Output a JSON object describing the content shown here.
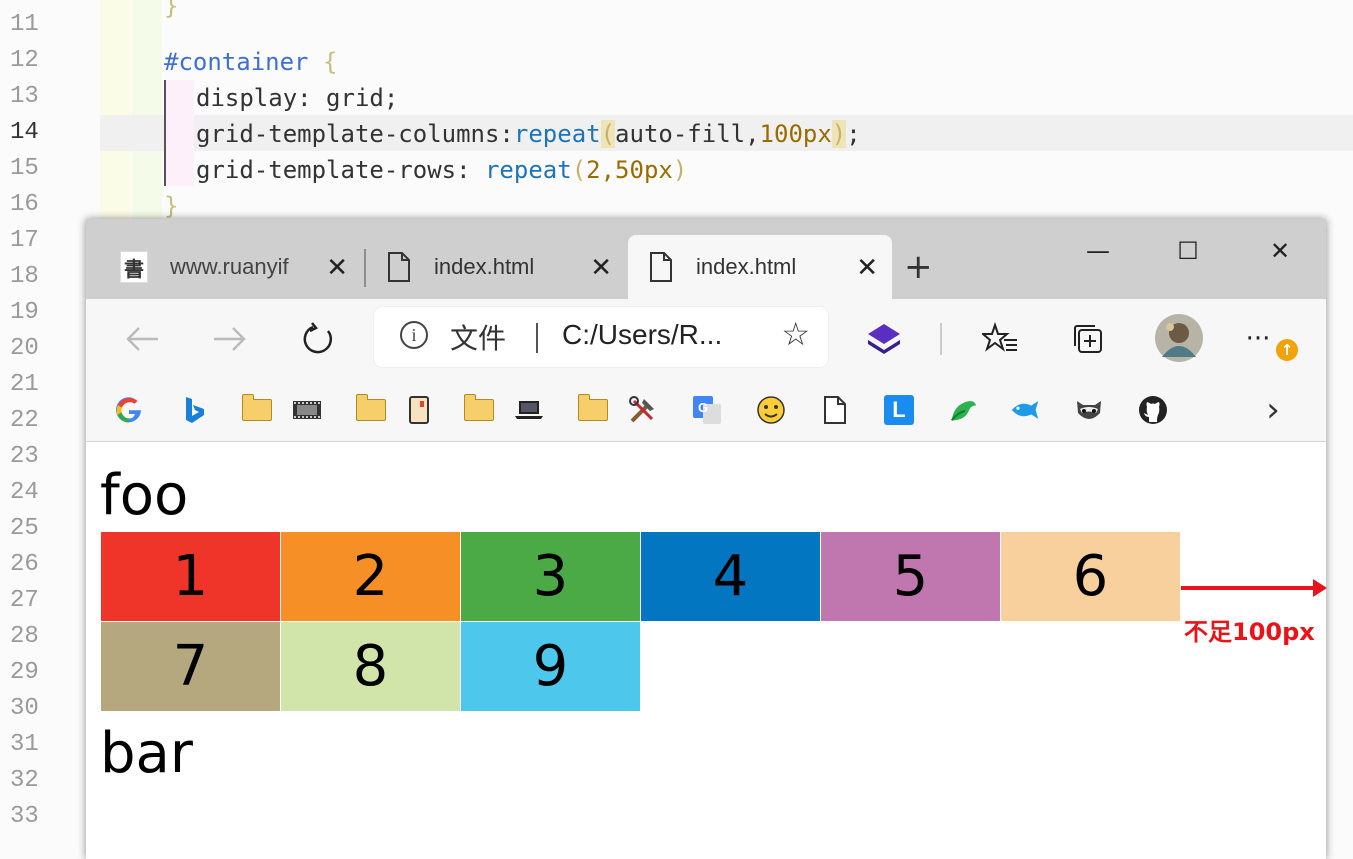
{
  "editor": {
    "line_numbers": [
      "11",
      "12",
      "13",
      "14",
      "15",
      "16",
      "17",
      "18",
      "19",
      "20",
      "21",
      "22",
      "23",
      "24",
      "25",
      "26",
      "27",
      "28",
      "29",
      "30",
      "31",
      "32",
      "33"
    ],
    "active_line": "14",
    "code": {
      "l11": "}",
      "l12_selector": "#container",
      "l12_brace": " {",
      "l13": "display: grid;",
      "l14_prop": "grid-template-columns:",
      "l14_fn": "repeat",
      "l14_open": "(",
      "l14_arg1": "auto-fill,",
      "l14_arg2": "100px",
      "l14_close": ")",
      "l14_end": ";",
      "l15_prop": "grid-template-rows: ",
      "l15_fn": "repeat",
      "l15_open": "(",
      "l15_arg1": "2,",
      "l15_arg2": "50px",
      "l15_close": ")",
      "l16": "}"
    }
  },
  "browser": {
    "tabs": [
      {
        "label": "www.ruanyif",
        "icon": "calligraphy-favicon",
        "close": "✕"
      },
      {
        "label": "index.html",
        "icon": "document-icon",
        "close": "✕"
      },
      {
        "label": "index.html",
        "icon": "document-icon",
        "close": "✕",
        "active": true
      }
    ],
    "new_tab": "+",
    "window_controls": {
      "minimize": "—",
      "maximize": "☐",
      "close": "✕"
    },
    "address": {
      "info": "i",
      "scheme_label": "文件",
      "url": "C:/Users/R...",
      "star": "☆"
    },
    "toolbar_icons": [
      "back-icon",
      "forward-icon",
      "refresh-icon",
      "extension-layers-icon",
      "favorites-icon",
      "collections-icon",
      "profile-avatar",
      "more-icon"
    ],
    "more_label": "···",
    "update_badge": "↑",
    "bookmarks": [
      "google",
      "bing",
      "folder-film",
      "folder-book",
      "folder-laptop",
      "folder-tools",
      "translate",
      "emoji",
      "document",
      "L-app",
      "bird",
      "fish",
      "raccoon",
      "github"
    ],
    "bookmarks_more": "›",
    "bm_l_label": "L"
  },
  "page": {
    "foo": "foo",
    "bar": "bar",
    "cells": [
      {
        "label": "1",
        "color": "#ef342a"
      },
      {
        "label": "2",
        "color": "#f68f26"
      },
      {
        "label": "3",
        "color": "#4ba946"
      },
      {
        "label": "4",
        "color": "#0376c2"
      },
      {
        "label": "5",
        "color": "#c077af"
      },
      {
        "label": "6",
        "color": "#f8d09d"
      },
      {
        "label": "7",
        "color": "#b5a87f"
      },
      {
        "label": "8",
        "color": "#d1e5aa"
      },
      {
        "label": "9",
        "color": "#4dc7ec"
      }
    ],
    "annotation": "不足100px"
  }
}
